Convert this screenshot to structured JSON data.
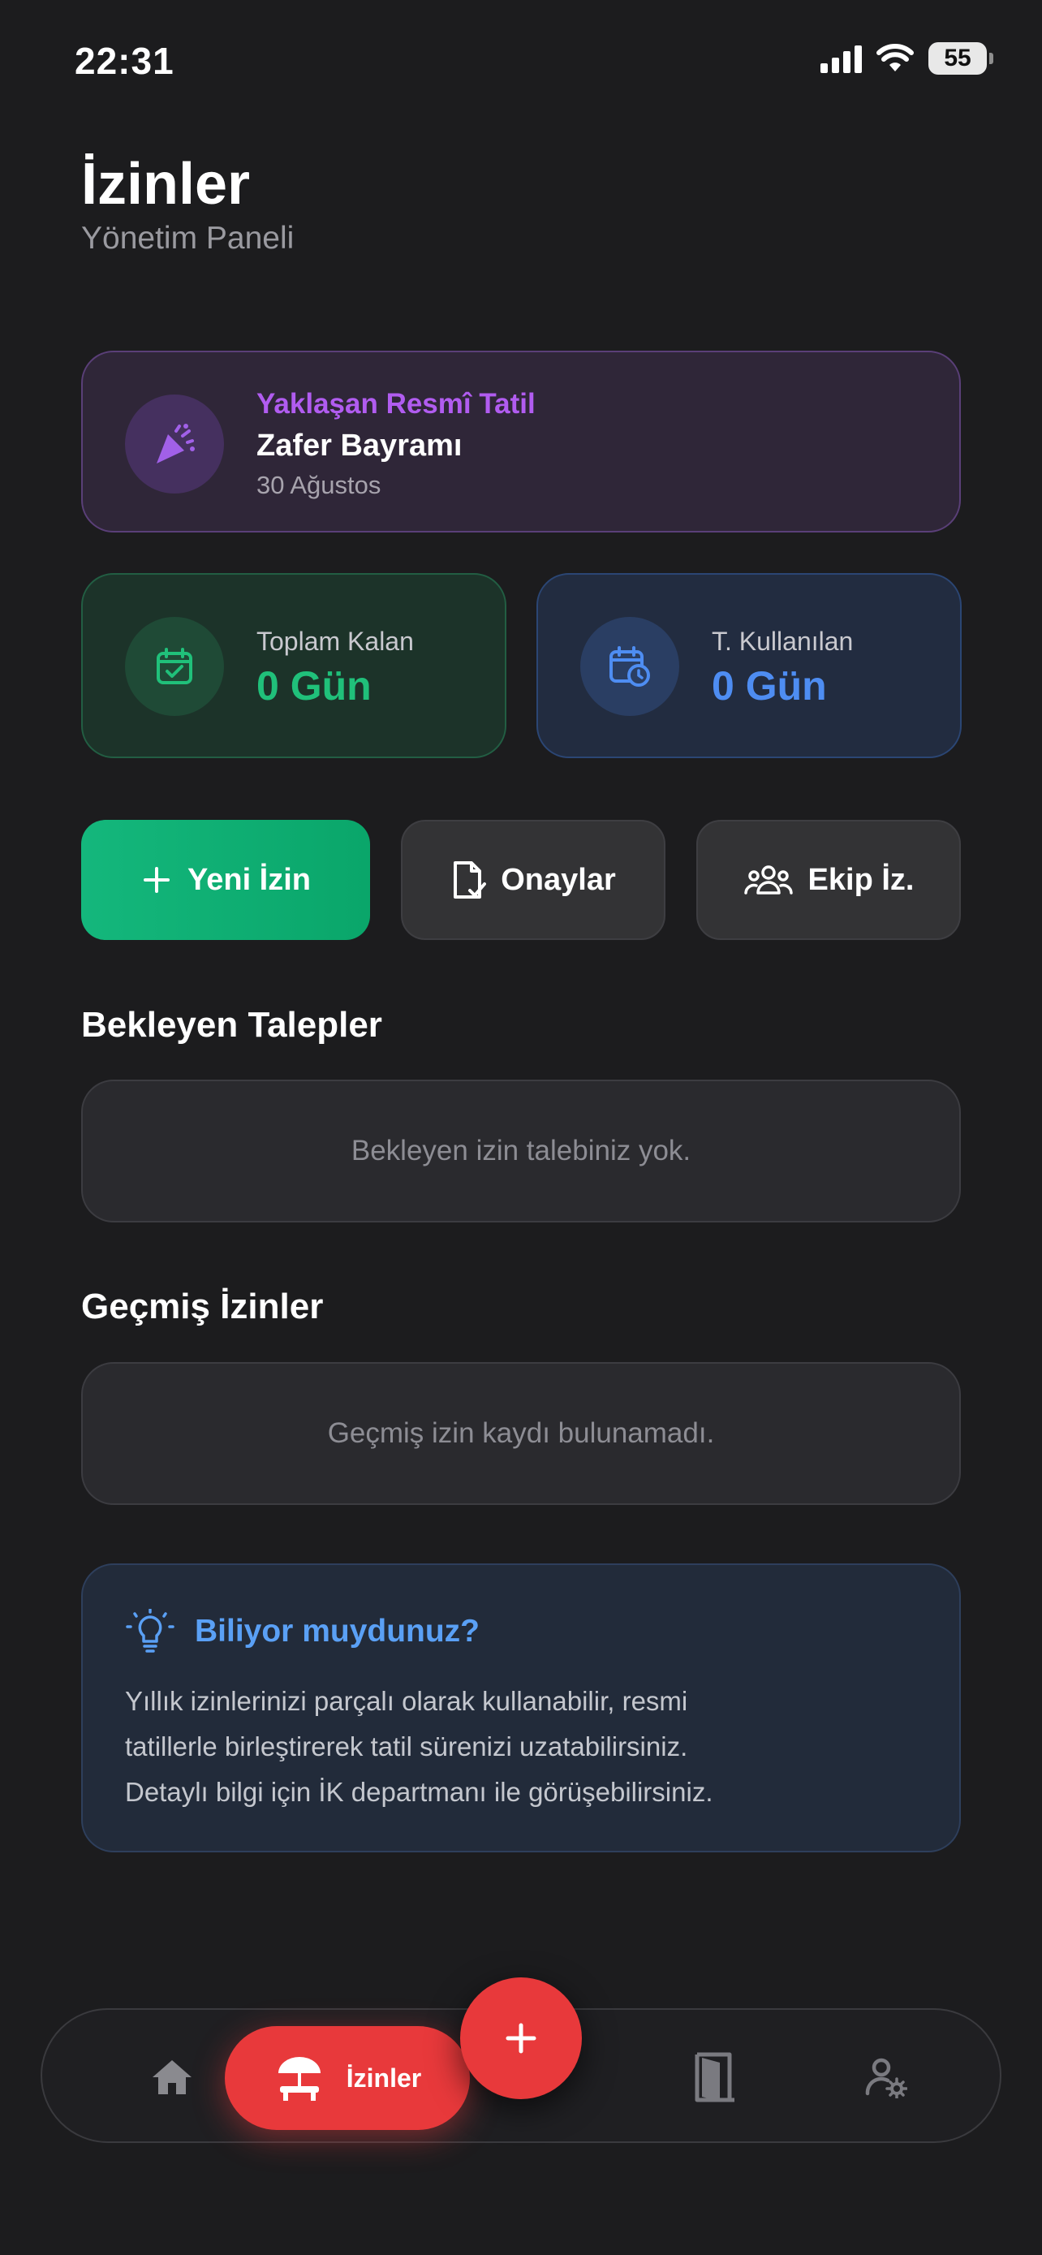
{
  "status_bar": {
    "time": "22:31",
    "battery": "55"
  },
  "header": {
    "title": "İzinler",
    "subtitle": "Yönetim Paneli"
  },
  "holiday": {
    "label": "Yaklaşan Resmî Tatil",
    "name": "Zafer Bayramı",
    "date": "30 Ağustos",
    "icon": "party-popper-icon",
    "accent": "#b15cf0"
  },
  "stats": [
    {
      "label": "Toplam Kalan",
      "value": "0 Gün",
      "icon": "calendar-check-icon",
      "color": "#20c07a"
    },
    {
      "label": "T. Kullanılan",
      "value": "0 Gün",
      "icon": "calendar-clock-icon",
      "color": "#4e8df2"
    }
  ],
  "actions": {
    "new_leave": "Yeni İzin",
    "approvals": "Onaylar",
    "team_leave": "Ekip İz."
  },
  "pending": {
    "title": "Bekleyen Talepler",
    "empty": "Bekleyen izin talebiniz yok."
  },
  "history": {
    "title": "Geçmiş İzinler",
    "empty": "Geçmiş izin kaydı bulunamadı."
  },
  "info": {
    "title": "Biliyor muydunuz?",
    "lines": [
      "Yıllık izinlerinizi parçalı olarak kullanabilir, resmi",
      "tatillerle birleştirerek tatil sürenizi uzatabilirsiniz.",
      "Detaylı bilgi için İK departmanı ile görüşebilirsiniz."
    ]
  },
  "bottom_nav": {
    "active_label": "İzinler",
    "items": [
      "home-icon",
      "beach-umbrella-icon",
      "door-icon",
      "user-settings-icon"
    ],
    "fab_icon": "plus-icon",
    "accent": "#e8393b"
  }
}
